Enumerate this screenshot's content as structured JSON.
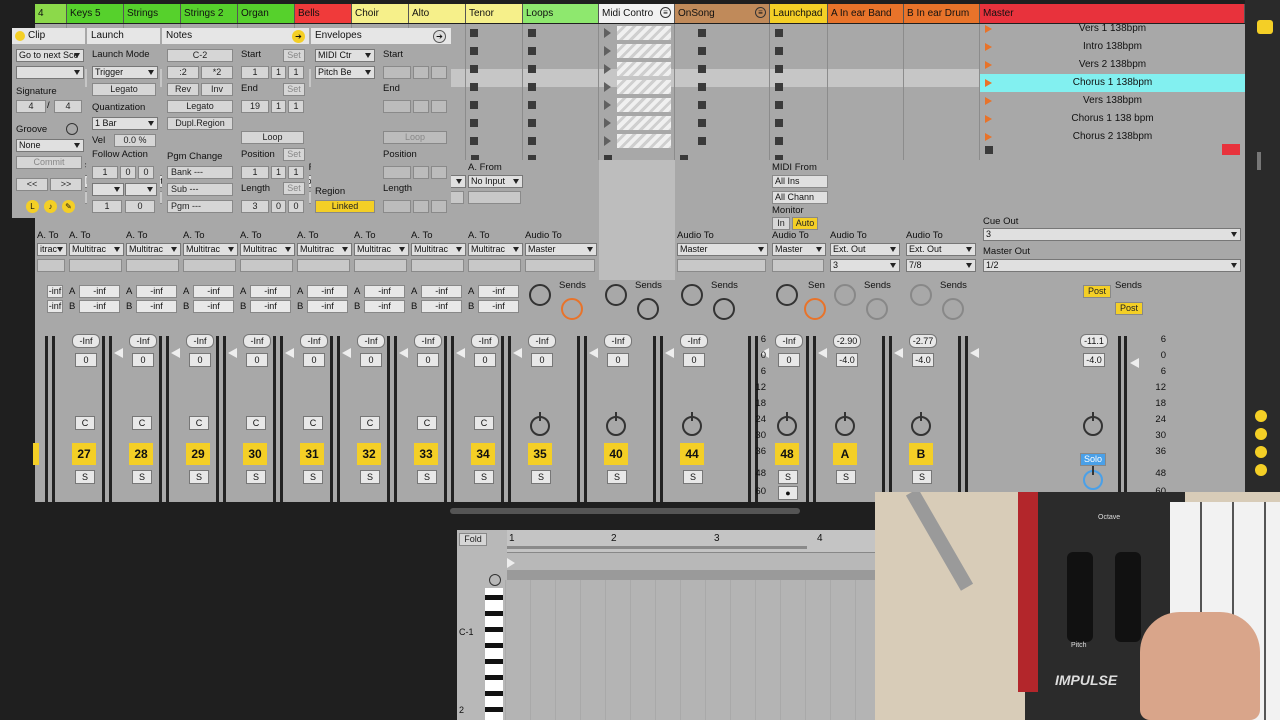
{
  "tracks": [
    {
      "name": "4",
      "color": "#8cd94a"
    },
    {
      "name": "Keys 5",
      "color": "#56d12c"
    },
    {
      "name": "Strings",
      "color": "#56d12c"
    },
    {
      "name": "Strings 2",
      "color": "#56d12c"
    },
    {
      "name": "Organ",
      "color": "#56d12c"
    },
    {
      "name": "Bells",
      "color": "#f03a3a"
    },
    {
      "name": "Choir",
      "color": "#f6f08a"
    },
    {
      "name": "Alto",
      "color": "#f6f08a"
    },
    {
      "name": "Tenor",
      "color": "#f6f08a"
    },
    {
      "name": "Loops",
      "color": "#8ee86e"
    },
    {
      "name": "Midi Contro",
      "color": "#f2f2f2"
    },
    {
      "name": "OnSong",
      "color": "#c08a5a"
    },
    {
      "name": "Launchpad",
      "color": "#f4cf26"
    },
    {
      "name": "A In ear Band",
      "color": "#e8732a"
    },
    {
      "name": "B In ear Drum",
      "color": "#e8732a"
    },
    {
      "name": "Master",
      "color": "#e8323c"
    }
  ],
  "scenes": [
    {
      "label": "Vers 1   138bpm"
    },
    {
      "label": "Intro   138bpm"
    },
    {
      "label": "Vers 2   138bpm"
    },
    {
      "label": "Chorus 1   138bpm"
    },
    {
      "label": "Vers   138bpm"
    },
    {
      "label": "Chorus 1   138 bpm"
    },
    {
      "label": "Chorus 2   138bpm"
    }
  ],
  "io": {
    "a_from": "A. From",
    "from_partial": "rom",
    "no_input": "No Input",
    "input_partial": "nput",
    "a_to": "A. To",
    "multitrac": "Multitrac",
    "itrac": "itrac",
    "audio_to": "Audio To",
    "master": "Master",
    "midi_from": "MIDI From",
    "all_ins": "All Ins",
    "all_chann": "All Chann",
    "monitor": "Monitor",
    "in": "In",
    "auto": "Auto",
    "ext_out": "Ext. Out",
    "ext_a": "3",
    "ext_b": "7/8",
    "cue_out": "Cue Out",
    "cue_val": "3",
    "master_out": "Master Out",
    "master_out_val": "1/2"
  },
  "sends": {
    "inf": "-inf",
    "sends_label": "Sends",
    "a": "A",
    "b": "B",
    "post": "Post",
    "sen": "Sen"
  },
  "mixer": {
    "vol_inf": "-Inf",
    "pan_zero": "0",
    "center": "C",
    "solo": "S",
    "solo_label": "Solo",
    "numbers": [
      "27",
      "28",
      "29",
      "30",
      "31",
      "32",
      "33",
      "34",
      "35",
      "40",
      "44",
      "48",
      "A",
      "B"
    ],
    "vol_a": "-2.90",
    "vol_b": "-2.77",
    "vol_master": "-11.1",
    "pan_a": "-4.0",
    "pan_b": "-4.0",
    "pan_master": "-4.0",
    "scale": [
      "6",
      "0",
      "6",
      "12",
      "18",
      "24",
      "30",
      "36",
      "48",
      "60"
    ]
  },
  "clip_panel": {
    "clip": "Clip",
    "go_next": "Go to next Sce",
    "signature": "Signature",
    "sig_num": "4",
    "sig_den": "4",
    "groove": "Groove",
    "none": "None",
    "commit": "Commit",
    "launch": "Launch",
    "launch_mode": "Launch Mode",
    "trigger": "Trigger",
    "legato": "Legato",
    "quantization": "Quantization",
    "bar": "1 Bar",
    "vel": "Vel",
    "vel_val": "0.0 %",
    "follow": "Follow Action",
    "fa1": "1",
    "fa2": "0",
    "fa3": "0",
    "fa4": "1",
    "fa5": "0",
    "notes": "Notes",
    "c2": "C-2",
    "div2": ":2",
    "mul2": "*2",
    "rev": "Rev",
    "inv": "Inv",
    "legato2": "Legato",
    "dupl": "Dupl.Region",
    "pgm_change": "Pgm Change",
    "bank": "Bank ---",
    "sub": "Sub ---",
    "pgm": "Pgm ---",
    "start": "Start",
    "set": "Set",
    "start1": "1",
    "start2": "1",
    "start3": "1",
    "end": "End",
    "end1": "19",
    "end2": "1",
    "end3": "1",
    "loop": "Loop",
    "position": "Position",
    "pos1": "1",
    "pos2": "1",
    "pos3": "1",
    "length": "Length",
    "len1": "3",
    "len2": "0",
    "len3": "0",
    "envelopes": "Envelopes",
    "midi_ctr": "MIDI Ctr",
    "pitch_be": "Pitch Be",
    "region": "Region",
    "linked": "Linked",
    "env_start": "Start",
    "env_end": "End",
    "env_loop": "Loop",
    "env_position": "Position",
    "env_length": "Length",
    "fold": "Fold",
    "ruler": [
      "1",
      "2",
      "3",
      "4"
    ],
    "c1": "C-1",
    "c2_key": "2"
  },
  "video": {
    "brand": "IMPULSE",
    "octave": "Octave",
    "pitch": "Pitch"
  }
}
